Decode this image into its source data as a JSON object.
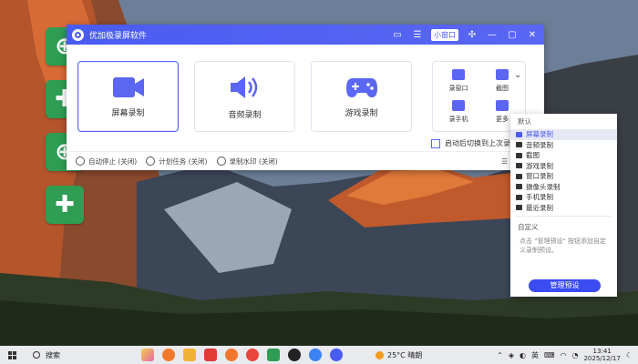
{
  "window": {
    "title": "优加极录屏软件",
    "small_window_label": "小窗口"
  },
  "cards": [
    {
      "label": "屏幕录制",
      "icon": "camera-icon"
    },
    {
      "label": "音频录制",
      "icon": "speaker-icon"
    },
    {
      "label": "游戏录制",
      "icon": "gamepad-icon"
    }
  ],
  "mini_panel": {
    "items": [
      {
        "label": "录窗口",
        "icon": "window-icon"
      },
      {
        "label": "截图",
        "icon": "screenshot-icon"
      },
      {
        "label": "录手机",
        "icon": "phone-icon"
      },
      {
        "label": "更多",
        "icon": "grid-icon"
      }
    ]
  },
  "checkbox_label": "启动后切换到上次录制",
  "bottom_bar": {
    "auto_stop": "自动停止 (关闭)",
    "schedule": "计划任务 (关闭)",
    "watermark": "录制水印 (关闭)"
  },
  "dropdown": {
    "default_section": "默认",
    "items": [
      {
        "label": "屏幕录制",
        "selected": true
      },
      {
        "label": "音频录制",
        "selected": false
      },
      {
        "label": "截图",
        "selected": false
      },
      {
        "label": "游戏录制",
        "selected": false
      },
      {
        "label": "窗口录制",
        "selected": false
      },
      {
        "label": "摄像头录制",
        "selected": false
      },
      {
        "label": "手机录制",
        "selected": false
      },
      {
        "label": "最近录制",
        "selected": false
      }
    ],
    "custom_section": "自定义",
    "hint": "点击 \"管理预设\" 按钮添加自定义录制预设。",
    "manage_button": "管理预设"
  },
  "taskbar": {
    "search_label": "搜索",
    "weather": "25°C 晴朗",
    "ime": "英",
    "time": "13:41",
    "date": "2025/12/17"
  },
  "colors": {
    "accent": "#4a5cf0",
    "title_bar": "#5a66f4",
    "desktop_icon": "#2f9d53"
  }
}
